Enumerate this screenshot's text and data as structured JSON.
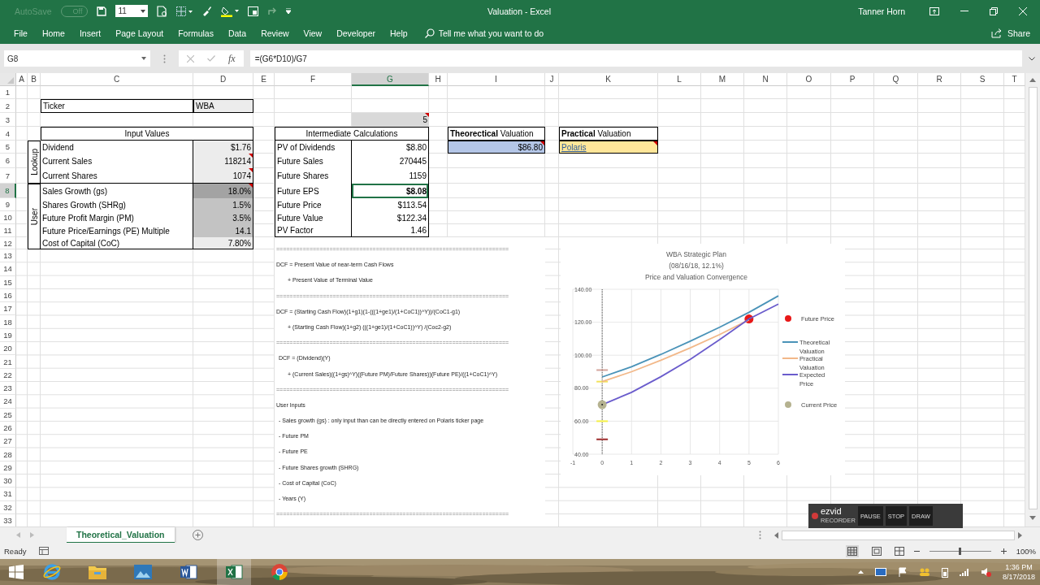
{
  "title_bar": {
    "autosave_label": "AutoSave",
    "autosave_state": "Off",
    "font_size": "11",
    "title": "Valuation  -  Excel",
    "user": "Tanner Horn"
  },
  "ribbon_tabs": [
    {
      "label": "File",
      "selected": false
    },
    {
      "label": "Home",
      "selected": false
    },
    {
      "label": "Insert",
      "selected": false
    },
    {
      "label": "Page Layout",
      "selected": false
    },
    {
      "label": "Formulas",
      "selected": false
    },
    {
      "label": "Data",
      "selected": false
    },
    {
      "label": "Review",
      "selected": false
    },
    {
      "label": "View",
      "selected": false
    },
    {
      "label": "Developer",
      "selected": false
    },
    {
      "label": "Help",
      "selected": false
    }
  ],
  "tell_me": {
    "placeholder": "Tell me what you want to do"
  },
  "share": "Share",
  "formula_bar": {
    "name_box": "G8",
    "function_label": "fx",
    "formula": "=(G6*D10)/G7"
  },
  "sheet": {
    "columns": [
      {
        "label": "A",
        "selected": false
      },
      {
        "label": "B",
        "selected": false
      },
      {
        "label": "C",
        "selected": false
      },
      {
        "label": "D",
        "selected": false
      },
      {
        "label": "E",
        "selected": false
      },
      {
        "label": "F",
        "selected": false
      },
      {
        "label": "G",
        "selected": true
      },
      {
        "label": "H",
        "selected": false
      },
      {
        "label": "I",
        "selected": false
      },
      {
        "label": "J",
        "selected": false
      },
      {
        "label": "K",
        "selected": false
      },
      {
        "label": "L",
        "selected": false
      },
      {
        "label": "M",
        "selected": false
      },
      {
        "label": "N",
        "selected": false
      },
      {
        "label": "O",
        "selected": false
      },
      {
        "label": "P",
        "selected": false
      },
      {
        "label": "Q",
        "selected": false
      },
      {
        "label": "R",
        "selected": false
      },
      {
        "label": "S",
        "selected": false
      },
      {
        "label": "T",
        "selected": false
      }
    ],
    "rows": [
      {
        "label": "1",
        "selected": false
      },
      {
        "label": "2",
        "selected": false
      },
      {
        "label": "3",
        "selected": false
      },
      {
        "label": "4",
        "selected": false
      },
      {
        "label": "5",
        "selected": false
      },
      {
        "label": "6",
        "selected": false
      },
      {
        "label": "7",
        "selected": false
      },
      {
        "label": "8",
        "selected": true
      },
      {
        "label": "9",
        "selected": false
      },
      {
        "label": "10",
        "selected": false
      },
      {
        "label": "11",
        "selected": false
      },
      {
        "label": "12",
        "selected": false
      },
      {
        "label": "13",
        "selected": false
      },
      {
        "label": "14",
        "selected": false
      },
      {
        "label": "15",
        "selected": false
      },
      {
        "label": "16",
        "selected": false
      },
      {
        "label": "17",
        "selected": false
      },
      {
        "label": "18",
        "selected": false
      },
      {
        "label": "19",
        "selected": false
      },
      {
        "label": "20",
        "selected": false
      },
      {
        "label": "21",
        "selected": false
      },
      {
        "label": "22",
        "selected": false
      },
      {
        "label": "23",
        "selected": false
      },
      {
        "label": "24",
        "selected": false
      },
      {
        "label": "25",
        "selected": false
      },
      {
        "label": "26",
        "selected": false
      },
      {
        "label": "27",
        "selected": false
      },
      {
        "label": "28",
        "selected": false
      },
      {
        "label": "29",
        "selected": false
      },
      {
        "label": "30",
        "selected": false
      },
      {
        "label": "31",
        "selected": false
      },
      {
        "label": "32",
        "selected": false
      },
      {
        "label": "33",
        "selected": false
      }
    ]
  },
  "ticker": {
    "label": "Ticker",
    "value": "WBA"
  },
  "years_cell": {
    "value": "5",
    "comment": true
  },
  "input_values": {
    "title": "Input Values",
    "groups": [
      {
        "label": "Lookup",
        "rows": [
          {
            "label": "Dividend",
            "value": "$1.76",
            "color": "#ececec",
            "comment": false
          },
          {
            "label": "Current Sales",
            "value": "118214",
            "color": "#ececec",
            "comment": true
          },
          {
            "label": "Current Shares",
            "value": "1074",
            "color": "#ececec",
            "comment": true
          }
        ]
      },
      {
        "label": "User",
        "rows": [
          {
            "label": "Sales Growth (gs)",
            "value": "18.0%",
            "color": "#a3a3a3",
            "comment": true
          },
          {
            "label": "Shares Growth (SHRg)",
            "value": "1.5%",
            "color": "#c3c3c3",
            "comment": false
          },
          {
            "label": "Future Profit Margin (PM)",
            "value": "3.5%",
            "color": "#c3c3c3",
            "comment": false
          },
          {
            "label": "Future Price/Earnings (PE) Multiple",
            "value": "14.1",
            "color": "#c3c3c3",
            "comment": false
          },
          {
            "label": "Cost of Capital (CoC)",
            "value": "7.80%",
            "color": "#ececec",
            "comment": false
          }
        ]
      }
    ]
  },
  "intermediate": {
    "title": "Intermediate Calculations",
    "rows": [
      {
        "label": "PV of Dividends",
        "value": "$8.80",
        "bold": false,
        "selected": false
      },
      {
        "label": "Future Sales",
        "value": "270445",
        "bold": false,
        "selected": false
      },
      {
        "label": "Future Shares",
        "value": "1159",
        "bold": false,
        "selected": false
      },
      {
        "label": "Future EPS",
        "value": "$8.08",
        "bold": true,
        "selected": true
      },
      {
        "label": "Future Price",
        "value": "$113.54",
        "bold": false,
        "selected": false
      },
      {
        "label": "Future Value",
        "value": "$122.34",
        "bold": false,
        "selected": false
      },
      {
        "label": "PV Factor",
        "value": "1.46",
        "bold": false,
        "selected": false
      }
    ]
  },
  "theoretical": {
    "title": "**Theorectical** Valuation",
    "value": "$86.80",
    "comment": true
  },
  "practical": {
    "title": "**Practical** Valuation",
    "value": "Polaris",
    "comment": true
  },
  "notes": [
    {
      "kind": "rule",
      "text": "======================================================================"
    },
    {
      "kind": "text",
      "text": "DCF = Present Value of near-term Cash Flows"
    },
    {
      "kind": "continuation",
      "text": "+ Present Value of Terminal Value"
    },
    {
      "kind": "rule",
      "text": "======================================================================"
    },
    {
      "kind": "text",
      "text": "DCF = (Starting Cash Flow)(1+g1)(1-(((1+ge1)/(1+CoC1))^Y))/(CoC1-g1)"
    },
    {
      "kind": "continuation",
      "text": "+ (Starting Cash Flow)(1+g2)     (((1+ge1)/(1+CoC1))^Y) /(Coc2-g2)"
    },
    {
      "kind": "rule",
      "text": "======================================================================"
    },
    {
      "kind": "bullet",
      "text": "DCF = (Dividend)(Y)"
    },
    {
      "kind": "continuation",
      "text": "+ (Current Sales)((1+gs)^Y)((Future PM)/Future Shares))(Future PE)/((1+CoC1)^Y)"
    },
    {
      "kind": "rule",
      "text": "======================================================================"
    },
    {
      "kind": "text",
      "text": "User Inputs"
    },
    {
      "kind": "bullet",
      "text": "- Sales growth (gs) : only input than can be directly entered on Polaris ticker page"
    },
    {
      "kind": "bullet",
      "text": "- Future PM"
    },
    {
      "kind": "bullet",
      "text": "- Future PE"
    },
    {
      "kind": "bullet",
      "text": "- Future Shares growth (SHRG)"
    },
    {
      "kind": "bullet",
      "text": "- Cost of Capital (CoC)"
    },
    {
      "kind": "bullet",
      "text": "- Years (Y)"
    },
    {
      "kind": "rule",
      "text": "======================================================================"
    }
  ],
  "chart": {
    "chart_data": {
      "type": "line",
      "title": "WBA Strategic Plan\n(08/16/18, 12.1%)\nPrice and Valuation Convergence",
      "x": [
        0,
        1,
        2,
        3,
        4,
        5,
        6
      ],
      "series": [
        {
          "name": "Future Price",
          "marker": true,
          "color": "#e81818",
          "values": [
            null,
            null,
            null,
            null,
            null,
            122,
            null
          ]
        },
        {
          "name": "Theoretical Valuation",
          "marker": false,
          "color": "#4a93b8",
          "values": [
            86.8,
            93,
            100.5,
            108.5,
            117,
            126,
            136
          ]
        },
        {
          "name": "Practical Valuation",
          "marker": false,
          "color": "#f2b889",
          "values": [
            84,
            90,
            97,
            104.5,
            112.5,
            121.5,
            null
          ]
        },
        {
          "name": "Expected Price",
          "marker": false,
          "color": "#6a5ccc",
          "values": [
            70,
            77.5,
            87,
            97.5,
            109.5,
            122,
            131
          ]
        },
        {
          "name": "Current Price",
          "marker": true,
          "color": "#b5b290",
          "values": [
            70,
            null,
            null,
            null,
            null,
            null,
            null
          ]
        }
      ],
      "grid": true,
      "legend": true,
      "ref_lines": [
        {
          "axis": "x",
          "value": 0
        }
      ],
      "xlim": [
        -1,
        6
      ],
      "ylim": [
        40,
        140
      ],
      "xticks": [
        -1,
        0,
        1,
        2,
        3,
        4,
        5,
        6
      ],
      "yticks": [
        {
          "value": 40,
          "label": "40.00"
        },
        {
          "value": 60,
          "label": "60.00"
        },
        {
          "value": 80,
          "label": "80.00"
        },
        {
          "value": 100,
          "label": "100.00"
        },
        {
          "value": 120,
          "label": "120.00"
        },
        {
          "value": 140,
          "label": "140.00"
        }
      ]
    }
  },
  "sheet_tabs": [
    {
      "label": "Theoretical_Valuation",
      "selected": true
    }
  ],
  "status": "Ready",
  "zoom": {
    "level": 0.5,
    "reading": "100%"
  },
  "recorder": {
    "brand": "ezvid",
    "label": "RECORDER",
    "buttons": [
      "PAUSE",
      "STOP",
      "DRAW"
    ]
  },
  "taskbar": {
    "apps": [
      {
        "kind": "ie",
        "selected": false
      },
      {
        "kind": "explorer",
        "selected": false
      },
      {
        "kind": "photos",
        "selected": false
      },
      {
        "kind": "word",
        "selected": false
      },
      {
        "kind": "excel",
        "selected": true
      },
      {
        "kind": "chrome",
        "selected": false
      }
    ],
    "time": "1:36 PM",
    "date": "8/17/2018"
  }
}
